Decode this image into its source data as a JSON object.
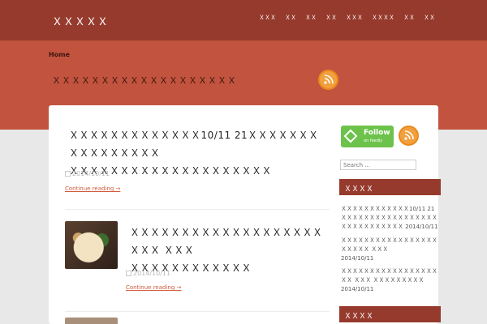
{
  "header": {
    "site_title": "ＸＸＸＸＸ",
    "nav": [
      "ＸＸＸ",
      "ＸＸ",
      "ＸＸ",
      "ＸＸ",
      "ＸＸＸ",
      "ＸＸＸＸ",
      "ＸＸ",
      "ＸＸ"
    ]
  },
  "banner": {
    "breadcrumb": "Home",
    "title": "ＸＸＸＸＸＸＸＸＸＸＸＸＸＸＸＸＸＸＸ"
  },
  "posts": [
    {
      "title_line1": "ＸＸＸＸＸＸＸＸＸＸＸＸＸ10/11 21ＸＸＸＸＸＸＸＸＸＸＸＸＸＸＸＸ",
      "title_line2": "ＸＸＸＸＸＸＸＸＸＸＸＸＸＸＸＸＸＸＸＸ",
      "date": "2014/10/11",
      "continue": "Continue reading →"
    },
    {
      "title_line1": "ＸＸＸＸＸＸＸＸＸＸＸＸＸＸＸＸＸＸＸＸＸＸ ＸＸＸ",
      "title_line2": "ＸＸＸＸＸＸＸＸＸＸＸＸ",
      "date": "2014/10/11",
      "continue": "Continue reading →"
    }
  ],
  "sidebar": {
    "feedly_follow": "Follow",
    "feedly_on": "on feedly",
    "search_placeholder": "Search ...",
    "recent_heading": "ＸＸＸＸ",
    "recent": [
      {
        "text": "ＸＸＸＸＸＸＸＸＸＸＸＸ10/11 21ＸＸＸＸＸＸＸＸＸＸＸＸＸＸＸＸＸＸＸＸＸＸＸＸＸＸＸＸ",
        "date": "2014/10/11"
      },
      {
        "text": "ＸＸＸＸＸＸＸＸＸＸＸＸＸＸＸＸＸＸＸＸＸＸ ＸＸＸ",
        "date": "2014/10/11"
      },
      {
        "text": "ＸＸＸＸＸＸＸＸＸＸＸＸＸＸＸＸＸＸＸ ＸＸＸ ＸＸＸＸＸＸＸＸＸ",
        "date": "2014/10/11"
      }
    ],
    "second_heading": "ＸＸＸＸ"
  },
  "colors": {
    "header_bg": "#963a2d",
    "banner_bg": "#c2533e",
    "link": "#d05a3c",
    "rss": "#f2a03d",
    "feedly": "#6cc24a"
  }
}
